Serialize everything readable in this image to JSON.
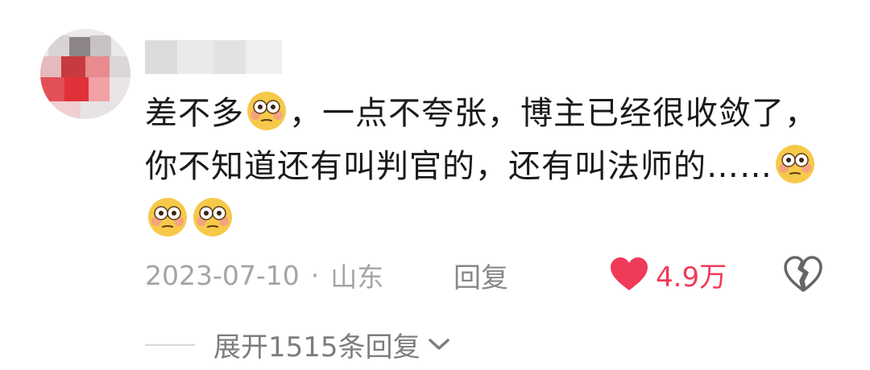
{
  "comment": {
    "text_part1": "差不多",
    "text_part2": "，一点不夸张，博主已经很收敛了，你不知道还有叫判官的，还有叫法师的……",
    "emoji_name": "flushed-face-emoji"
  },
  "meta": {
    "date": "2023-07-10",
    "separator": "·",
    "location": "山东",
    "reply_label": "回复"
  },
  "like": {
    "count": "4.9万",
    "color": "#f03a5a"
  },
  "expand": {
    "label": "展开1515条回复"
  }
}
